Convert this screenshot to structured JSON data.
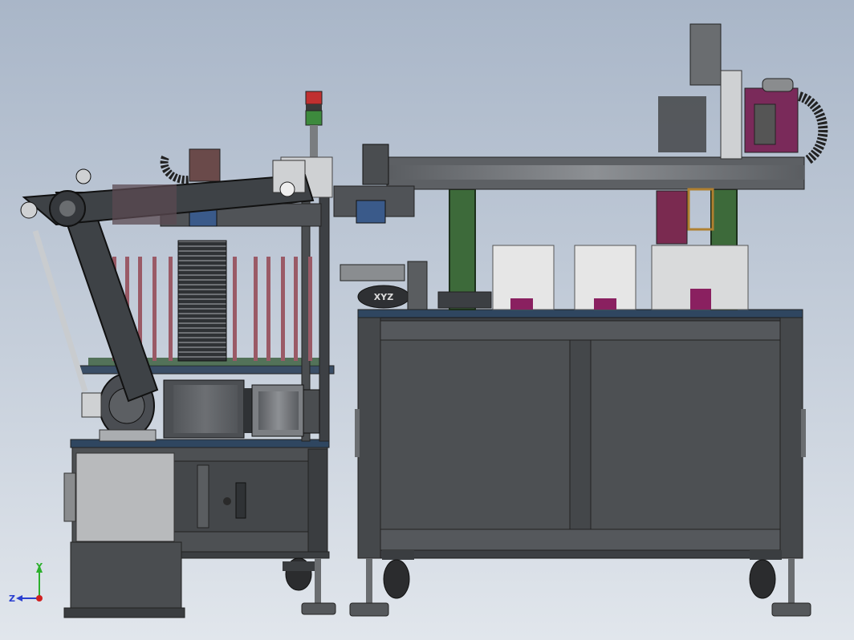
{
  "model_labels": {
    "nameplate": "XYZ"
  },
  "view_triad": {
    "y_axis": "Y",
    "z_axis": "Z"
  },
  "colors": {
    "background_top": "#a9b6c8",
    "background_bottom": "#e1e6ec",
    "frame_dark": "#3c3f43",
    "panel": "#4d5053",
    "arm": "#3e4246",
    "beam_green": "#3d6a3a",
    "rods": "#9a5a66",
    "box_white": "#e6e6e6",
    "accent_magenta": "#8a2060",
    "tower_red": "#c03030",
    "tower_green": "#3d8a3d"
  }
}
